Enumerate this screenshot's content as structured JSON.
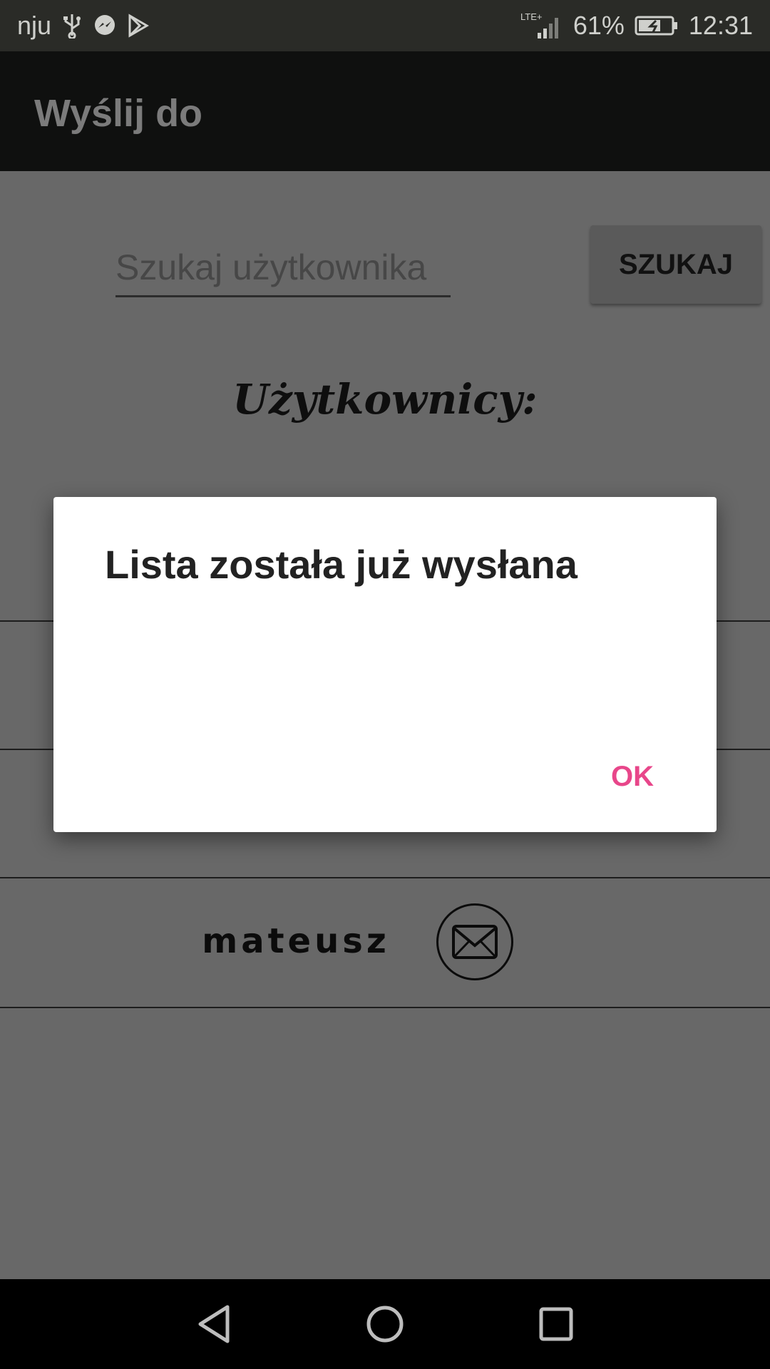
{
  "status_bar": {
    "carrier": "nju",
    "network": "LTE+",
    "battery": "61%",
    "time": "12:31",
    "icons": [
      "usb-icon",
      "messenger-icon",
      "play-store-icon",
      "signal-icon",
      "battery-charging-icon"
    ]
  },
  "app_bar": {
    "title": "Wyślij do"
  },
  "search": {
    "placeholder": "Szukaj użytkownika",
    "value": "",
    "button_label": "SZUKAJ"
  },
  "users": {
    "heading": "Użytkownicy:",
    "items": [
      {
        "name": "mateusz",
        "action_icon": "envelope-icon"
      }
    ]
  },
  "dialog": {
    "title": "Lista została już wysłana",
    "ok_label": "OK",
    "accent_color": "#e8468a"
  },
  "nav_bar": {
    "icons": [
      "back-icon",
      "home-icon",
      "recents-icon"
    ]
  }
}
